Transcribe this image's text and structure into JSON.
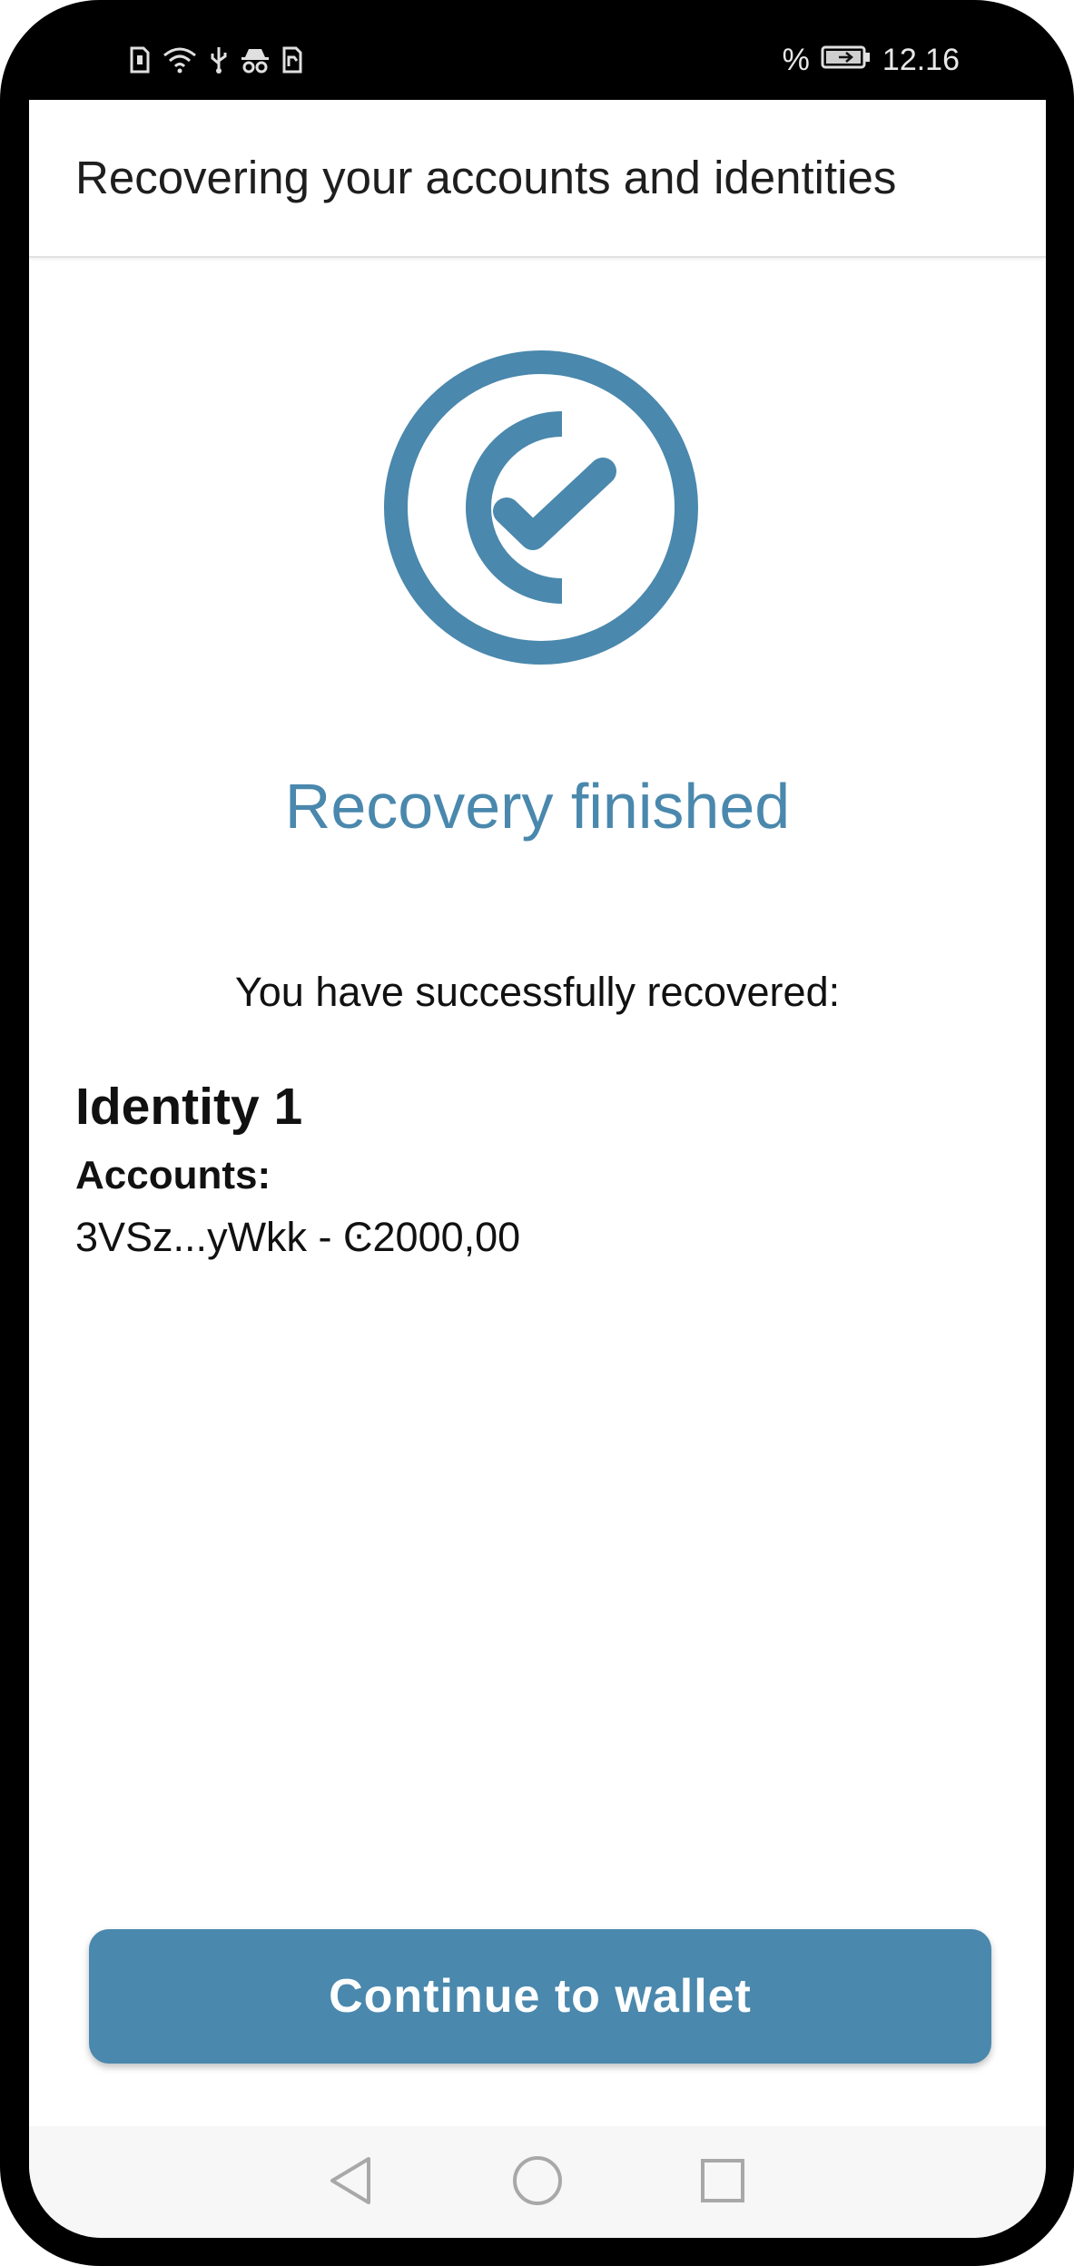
{
  "status_bar": {
    "left_icons": [
      "sim-card-icon",
      "wifi-icon",
      "usb-icon",
      "incognito-icon",
      "sd-card-icon"
    ],
    "battery_percent_symbol": "%",
    "battery_icon": "battery-charging-icon",
    "time": "12.16"
  },
  "app_bar": {
    "title": "Recovering your accounts and identities"
  },
  "main": {
    "success_icon": "concordium-check-icon",
    "heading": "Recovery finished",
    "subtitle": "You have successfully recovered:",
    "identities": [
      {
        "name": "Identity 1",
        "accounts_label": "Accounts:",
        "accounts": [
          {
            "text": "3VSz...yWkk - Ͼ2000,00"
          }
        ]
      }
    ],
    "continue_label": "Continue to wallet"
  },
  "nav_bar": {
    "icons": [
      "back-icon",
      "home-icon",
      "recents-icon"
    ]
  },
  "colors": {
    "accent": "#4a88ad",
    "text": "#111111",
    "background": "#ffffff",
    "bezel": "#000000"
  }
}
